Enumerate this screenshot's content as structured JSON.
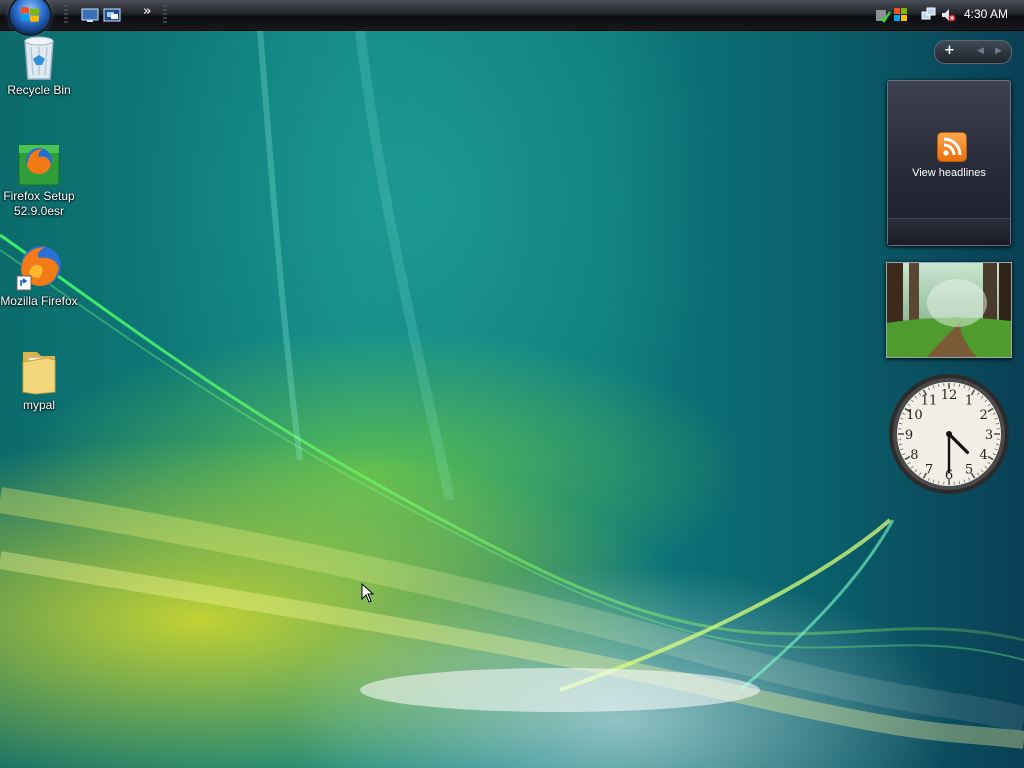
{
  "taskbar": {
    "start_button": "start-orb",
    "quick_launch": [
      "show-desktop-icon",
      "switch-windows-icon"
    ],
    "overflow_label": "»",
    "tray": {
      "icons": [
        "security-center-icon",
        "windows-update-icon",
        "network-icon",
        "volume-muted-icon"
      ],
      "clock": "4:30 AM"
    }
  },
  "desktop": {
    "icons": [
      {
        "label": "Recycle Bin",
        "icon": "recycle-bin-icon"
      },
      {
        "label": "Firefox Setup 52.9.0esr",
        "icon": "firefox-setup-icon"
      },
      {
        "label": "Mozilla Firefox",
        "icon": "firefox-icon"
      },
      {
        "label": "mypal",
        "icon": "folder-icon"
      }
    ]
  },
  "sidebar": {
    "controls": {
      "add": "+",
      "prev": "◀",
      "next": "▶"
    },
    "feed_gadget": {
      "label": "View headlines",
      "icon": "rss-icon"
    },
    "slideshow_gadget": {
      "icon": "forest-photo"
    },
    "clock_gadget": {
      "hour": 4,
      "minute": 30,
      "numbers": [
        "12",
        "1",
        "2",
        "3",
        "4",
        "5",
        "6",
        "7",
        "8",
        "9",
        "10",
        "11"
      ]
    }
  },
  "colors": {
    "taskbar": "#16181c",
    "wallpaper_teal": "#0f8583",
    "wallpaper_yellow": "#e1e128",
    "rss_orange": "#f08a24"
  }
}
